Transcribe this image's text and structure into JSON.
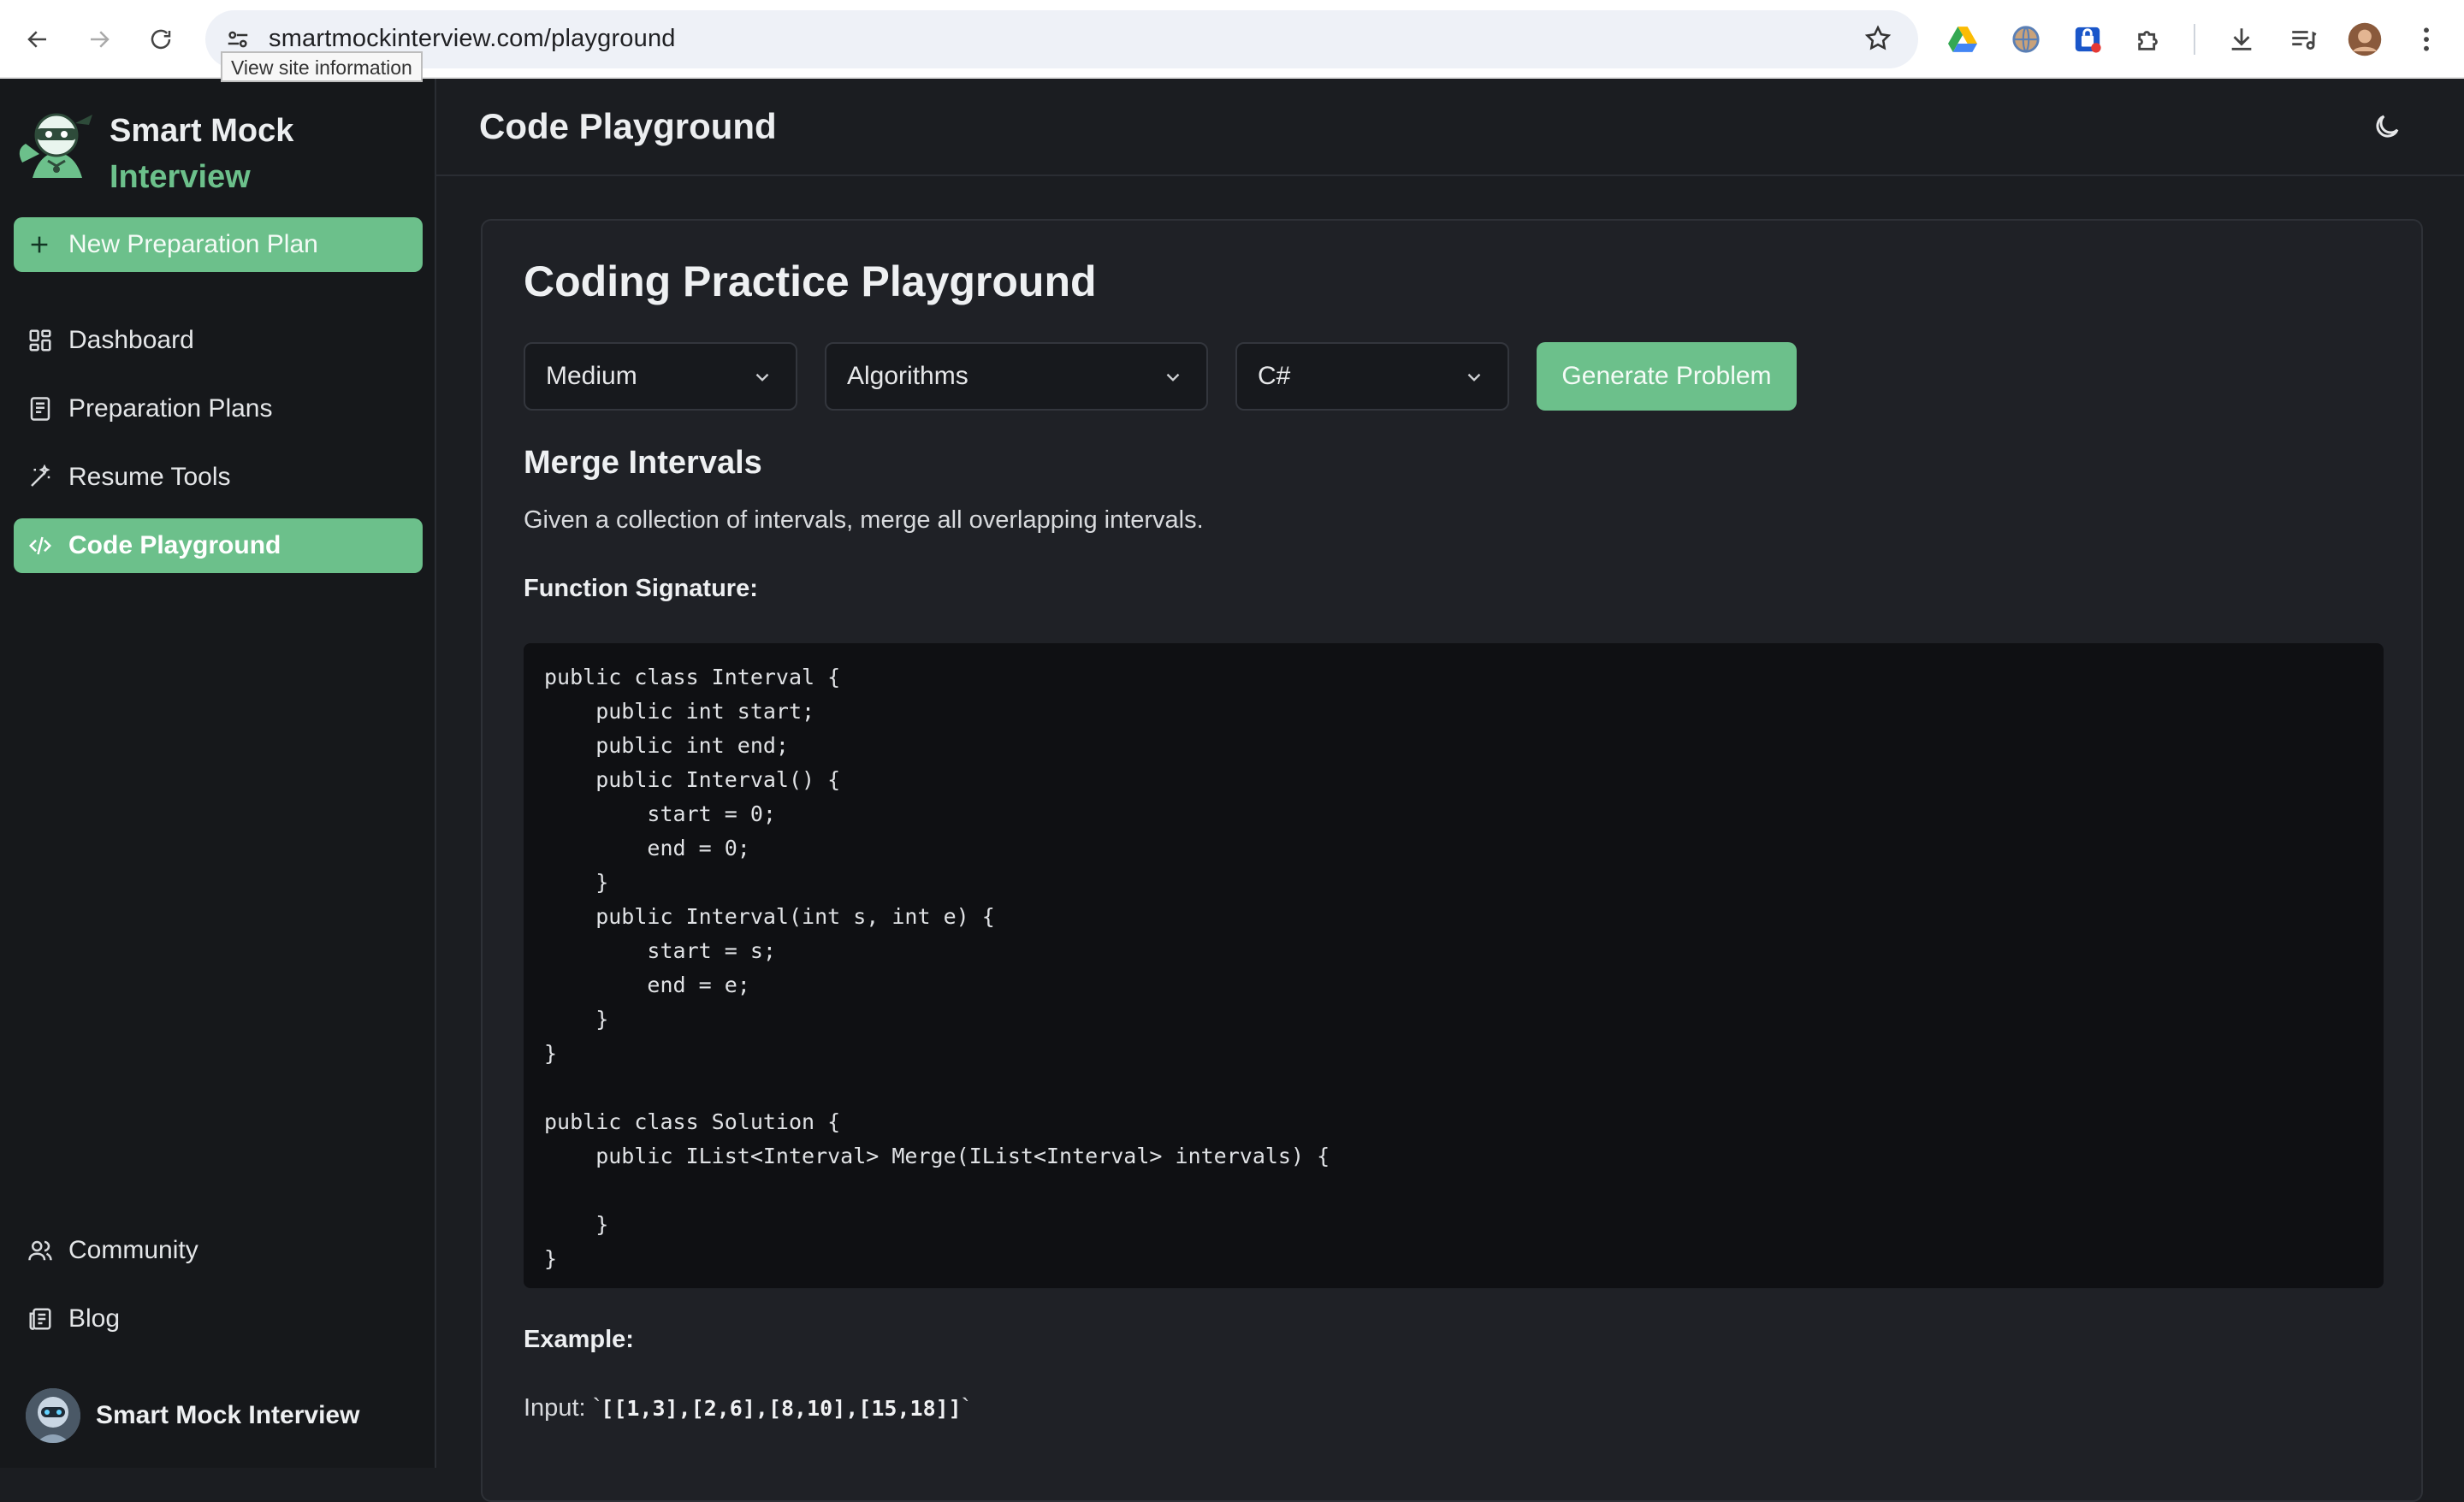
{
  "browser": {
    "url": "smartmockinterview.com/playground",
    "tooltip": "View site information"
  },
  "sidebar": {
    "brand_line1": "Smart Mock",
    "brand_line2": "Interview",
    "new_plan_label": "New Preparation Plan",
    "items": [
      {
        "label": "Dashboard",
        "icon": "dashboard-icon"
      },
      {
        "label": "Preparation Plans",
        "icon": "document-icon"
      },
      {
        "label": "Resume Tools",
        "icon": "wand-icon"
      },
      {
        "label": "Code Playground",
        "icon": "code-icon",
        "active": true
      }
    ],
    "bottom_items": [
      {
        "label": "Community",
        "icon": "users-icon"
      },
      {
        "label": "Blog",
        "icon": "newspaper-icon"
      }
    ],
    "profile_name": "Smart Mock Interview"
  },
  "header": {
    "title": "Code Playground"
  },
  "playground": {
    "title": "Coding Practice Playground",
    "difficulty": "Medium",
    "topic": "Algorithms",
    "language": "C#",
    "generate_label": "Generate Problem",
    "problem_title": "Merge Intervals",
    "problem_description": "Given a collection of intervals, merge all overlapping intervals.",
    "signature_label": "Function Signature:",
    "code": "public class Interval {\n    public int start;\n    public int end;\n    public Interval() {\n        start = 0;\n        end = 0;\n    }\n    public Interval(int s, int e) {\n        start = s;\n        end = e;\n    }\n}\n\npublic class Solution {\n    public IList<Interval> Merge(IList<Interval> intervals) {\n\n    }\n}",
    "example_label": "Example:",
    "example_input_prefix": "Input: `",
    "example_input_value": "[[1,3],[2,6],[8,10],[15,18]]",
    "example_input_suffix": "`"
  },
  "colors": {
    "accent": "#6cc08b",
    "background": "#1b1d21",
    "sidebar": "#16181b",
    "code_bg": "#0f1013"
  }
}
